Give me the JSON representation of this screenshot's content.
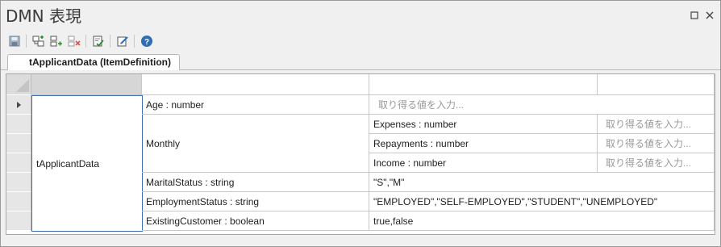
{
  "window": {
    "title": "DMN 表現"
  },
  "toolbar": {
    "icons": [
      "save-icon",
      "add-child-icon",
      "add-sibling-icon",
      "delete-icon",
      "validate-icon",
      "edit-icon",
      "help-icon"
    ],
    "colors": {
      "green": "#2e8b2e",
      "blue": "#2f6db5",
      "red": "#d9534f",
      "gray": "#8a8a8a"
    }
  },
  "tab": {
    "label": "tApplicantData (ItemDefinition)"
  },
  "grid": {
    "root_name": "tApplicantData",
    "placeholder": "取り得る値を入力...",
    "rows": [
      {
        "name": "Age : number"
      },
      {
        "name": "Monthly",
        "children": [
          {
            "name": "Expenses : number"
          },
          {
            "name": "Repayments : number"
          },
          {
            "name": "Income : number"
          }
        ]
      },
      {
        "name": "MaritalStatus : string",
        "values": "\"S\",\"M\""
      },
      {
        "name": "EmploymentStatus : string",
        "values": "\"EMPLOYED\",\"SELF-EMPLOYED\",\"STUDENT\",\"UNEMPLOYED\""
      },
      {
        "name": "ExistingCustomer : boolean",
        "values": "true,false"
      }
    ]
  }
}
